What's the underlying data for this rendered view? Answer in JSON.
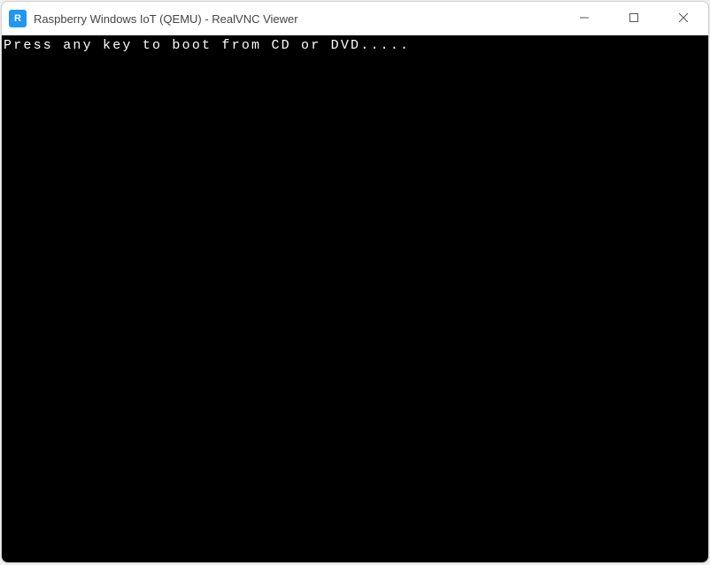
{
  "window": {
    "title": "Raspberry Windows IoT (QEMU) - RealVNC Viewer",
    "app_icon_label": "R"
  },
  "content": {
    "boot_message": "Press any key to boot from CD or DVD....."
  }
}
